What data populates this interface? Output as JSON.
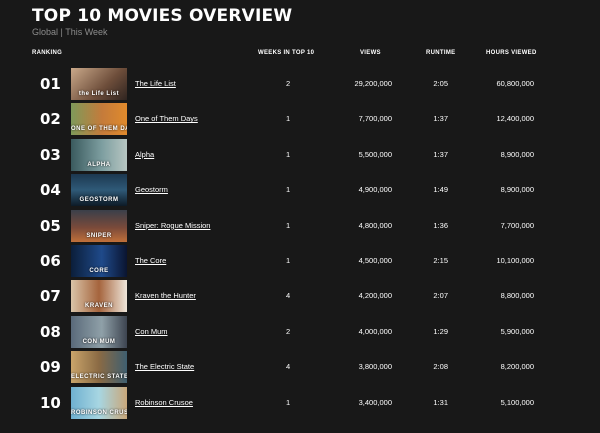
{
  "page": {
    "title": "TOP 10 MOVIES OVERVIEW",
    "subtitle": "Global | This Week"
  },
  "columns": {
    "ranking": "RANKING",
    "weeks": "WEEKS IN TOP 10",
    "views": "VIEWS",
    "runtime": "RUNTIME",
    "hours": "HOURS VIEWED"
  },
  "colors": {
    "background": "#181818",
    "text": "#ffffff",
    "muted": "#8c8c8c"
  },
  "rows": [
    {
      "rank": "01",
      "title": "The Life List",
      "weeks": "2",
      "views": "29,200,000",
      "runtime": "2:05",
      "hours": "60,800,000",
      "thumb": {
        "bg": "linear-gradient(135deg,#caa98a 0%,#6d4d3a 60%,#2f2420 100%)",
        "caption": "the Life List"
      }
    },
    {
      "rank": "02",
      "title": "One of Them Days",
      "weeks": "1",
      "views": "7,700,000",
      "runtime": "1:37",
      "hours": "12,400,000",
      "thumb": {
        "bg": "linear-gradient(90deg,#7e9a5a 0%,#c47b3b 55%,#e08a2c 100%)",
        "caption": "ONE OF THEM DAYS"
      }
    },
    {
      "rank": "03",
      "title": "Alpha",
      "weeks": "1",
      "views": "5,500,000",
      "runtime": "1:37",
      "hours": "8,900,000",
      "thumb": {
        "bg": "linear-gradient(90deg,#3a5a5e 0%,#7d9ea0 55%,#b7c6c2 100%)",
        "caption": "ALPHA"
      }
    },
    {
      "rank": "04",
      "title": "Geostorm",
      "weeks": "1",
      "views": "4,900,000",
      "runtime": "1:49",
      "hours": "8,900,000",
      "thumb": {
        "bg": "linear-gradient(180deg,#1c3850 0%,#2f5a78 50%,#0d1a26 100%)",
        "caption": "GEOSTORM"
      }
    },
    {
      "rank": "05",
      "title": "Sniper: Rogue Mission",
      "weeks": "1",
      "views": "4,800,000",
      "runtime": "1:36",
      "hours": "7,700,000",
      "thumb": {
        "bg": "linear-gradient(180deg,#3a3f4a 0%,#7a4a3a 55%,#c0703a 100%)",
        "caption": "SNIPER"
      }
    },
    {
      "rank": "06",
      "title": "The Core",
      "weeks": "1",
      "views": "4,500,000",
      "runtime": "2:15",
      "hours": "10,100,000",
      "thumb": {
        "bg": "linear-gradient(90deg,#0b1e3a 0%,#1f4a8a 55%,#0a1430 100%)",
        "caption": "CORE"
      }
    },
    {
      "rank": "07",
      "title": "Kraven the Hunter",
      "weeks": "4",
      "views": "4,200,000",
      "runtime": "2:07",
      "hours": "8,800,000",
      "thumb": {
        "bg": "linear-gradient(90deg,#d9c4a8 0%,#a5643d 50%,#efe6da 100%)",
        "caption": "KRAVEN"
      }
    },
    {
      "rank": "08",
      "title": "Con Mum",
      "weeks": "2",
      "views": "4,000,000",
      "runtime": "1:29",
      "hours": "5,900,000",
      "thumb": {
        "bg": "linear-gradient(90deg,#5a6a7a 0%,#8fa0a8 55%,#3d4450 100%)",
        "caption": "CON MUM"
      }
    },
    {
      "rank": "09",
      "title": "The Electric State",
      "weeks": "4",
      "views": "3,800,000",
      "runtime": "2:08",
      "hours": "8,200,000",
      "thumb": {
        "bg": "linear-gradient(90deg,#c9a46a 0%,#8a6a44 50%,#3f5f70 100%)",
        "caption": "ELECTRIC STATE"
      }
    },
    {
      "rank": "10",
      "title": "Robinson Crusoe",
      "weeks": "1",
      "views": "3,400,000",
      "runtime": "1:31",
      "hours": "5,100,000",
      "thumb": {
        "bg": "linear-gradient(90deg,#6fb0d0 0%,#a7d6e2 50%,#c9a77a 100%)",
        "caption": "ROBINSON CRUSOE"
      }
    }
  ]
}
